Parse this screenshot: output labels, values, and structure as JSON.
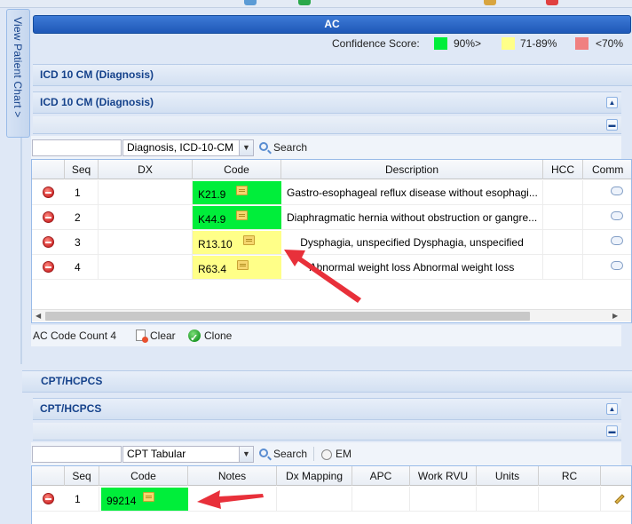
{
  "side_tab": {
    "label": "View Patient Chart  >"
  },
  "ac_panel": {
    "title": "AC",
    "confidence_label": "Confidence Score:",
    "legend": [
      {
        "label": "90%>",
        "color": "#00ee3a"
      },
      {
        "label": "71-89%",
        "color": "#ffff88"
      },
      {
        "label": "<70%",
        "color": "#f08080"
      }
    ]
  },
  "icd": {
    "outer_title": "ICD 10 CM (Diagnosis)",
    "inner_title": "ICD 10 CM (Diagnosis)",
    "search_value": "",
    "code_set": "Diagnosis, ICD-10-CM",
    "search_label": "Search",
    "columns": [
      "Seq",
      "DX",
      "Code",
      "Description",
      "HCC",
      "Comm"
    ],
    "rows": [
      {
        "seq": "1",
        "dx": "",
        "code": "K21.9",
        "code_color": "#00ee3a",
        "description": "Gastro-esophageal reflux disease without esophagi...",
        "align": "left"
      },
      {
        "seq": "2",
        "dx": "",
        "code": "K44.9",
        "code_color": "#00ee3a",
        "description": "Diaphragmatic hernia without obstruction or gangre...",
        "align": "left"
      },
      {
        "seq": "3",
        "dx": "",
        "code": "R13.10",
        "code_color": "#ffff88",
        "description": "Dysphagia, unspecified Dysphagia, unspecified",
        "align": "center"
      },
      {
        "seq": "4",
        "dx": "",
        "code": "R63.4",
        "code_color": "#ffff88",
        "description": "Abnormal weight loss Abnormal weight loss",
        "align": "center"
      }
    ],
    "code_count": "AC Code Count 4",
    "clear_label": "Clear",
    "clone_label": "Clone"
  },
  "cpt": {
    "outer_title": "CPT/HCPCS",
    "inner_title": "CPT/HCPCS",
    "search_value": "",
    "code_set": "CPT Tabular",
    "search_label": "Search",
    "em_label": "EM",
    "columns": [
      "Seq",
      "Code",
      "Notes",
      "Dx Mapping",
      "APC",
      "Work RVU",
      "Units",
      "RC"
    ],
    "rows": [
      {
        "seq": "1",
        "code": "99214",
        "code_color": "#00ee3a",
        "notes": "",
        "dx_mapping": "",
        "apc": "",
        "work_rvu": "",
        "units": "",
        "rc": ""
      }
    ]
  },
  "colors": {
    "accent": "#1f58b8",
    "header_text": "#15428b",
    "arrow": "#e8303a"
  }
}
